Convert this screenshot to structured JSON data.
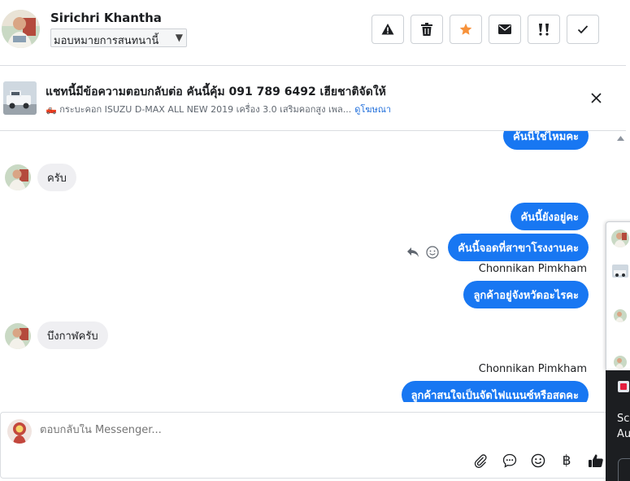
{
  "contact": {
    "name": "Sirichri Khantha",
    "assign_value": "มอบหมายการสนทนานี้"
  },
  "toolbar": {
    "actions": [
      {
        "icon": "warning-icon",
        "label": "Report"
      },
      {
        "icon": "trash-icon",
        "label": "Delete"
      },
      {
        "icon": "star-icon",
        "label": "Star"
      },
      {
        "icon": "envelope-icon",
        "label": "Mark unread"
      },
      {
        "icon": "follow-up-icon",
        "label": "Follow up"
      },
      {
        "icon": "check-icon",
        "label": "Done"
      }
    ],
    "star_color": "#f7923b"
  },
  "ad_banner": {
    "title": "แชทนี้มีข้อความตอบกลับต่อ คันนี้คุ้ม 091 789 6492 เฮียชาติจัดให้",
    "subtitle": "🛻 กระบะคอก ISUZU D-MAX ALL NEW 2019 เครื่อง 3.0 เสริมคอกสูง เพล...",
    "link": "ดูโฆษณา"
  },
  "messages": {
    "out_top": "คันนี้ใช่ไหมคะ",
    "in_1": "ครับ",
    "out_2": "คันนี้ยังอยู่คะ",
    "out_3": "คันนี้จอดที่สาขาโรงงานคะ",
    "sender_1": "Chonnikan Pimkham",
    "out_4": "ลูกค้าอยู่จังหวัดอะไรคะ",
    "in_2": "บึงกาฬครับ",
    "sender_2": "Chonnikan Pimkham",
    "out_5": "ลูกค้าสนใจเป็นจัดไฟแนนซ์หรือสดคะ"
  },
  "composer": {
    "placeholder": "ตอบกลับใน Messenger..."
  },
  "side_panel": {
    "dark_line_1": "Sc",
    "dark_line_2": "Au"
  },
  "colors": {
    "accent": "#1877f2",
    "incoming_bubble": "#efeff2"
  }
}
